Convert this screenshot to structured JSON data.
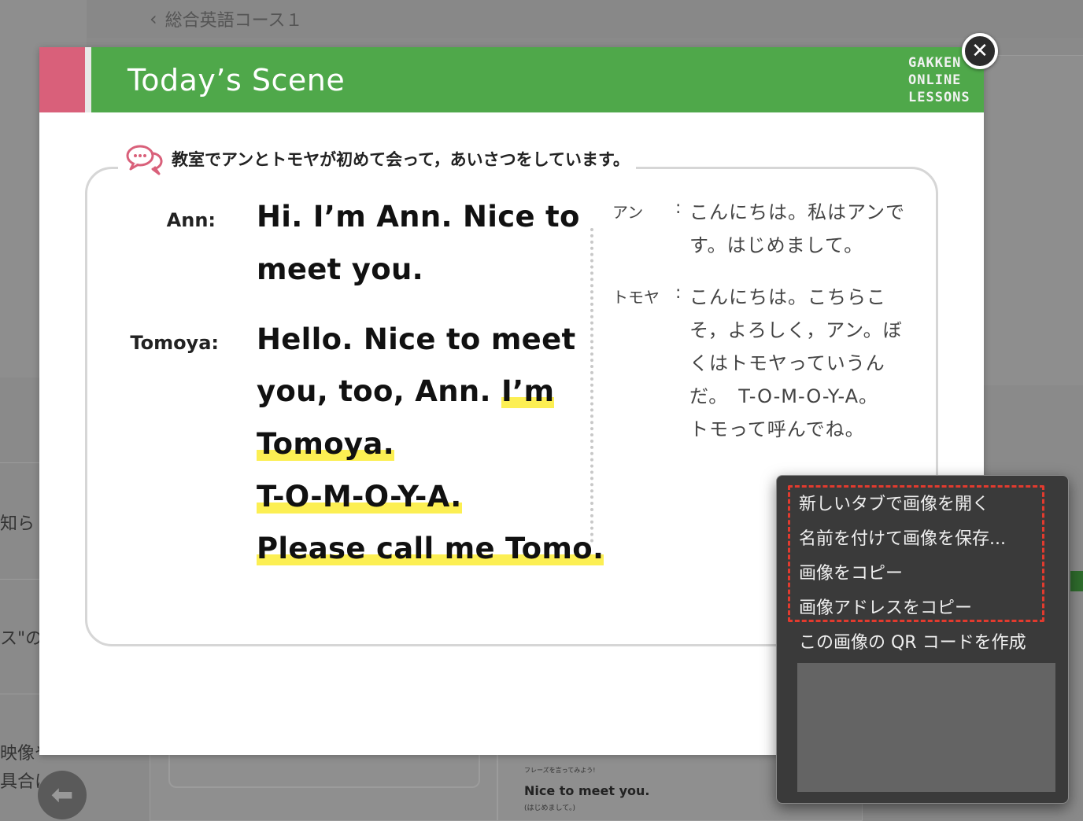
{
  "background": {
    "back_label": "総合英語コース１",
    "side_texts": [
      "知ら",
      "ス\"の",
      "映像や",
      "具合に"
    ],
    "card_phrase_hint": "フレーズを言ってみよう!",
    "card_phrase": "Nice to meet you.",
    "card_phrase_jp": "(はじめまして。)"
  },
  "modal": {
    "title": "Today’s Scene",
    "brand": [
      "GAKKEN",
      "ONLINE",
      "LESSONS"
    ],
    "intro": "教室でアンとトモヤが初めて会って，あいさつをしています。",
    "dialogue": [
      {
        "speaker": "Ann:",
        "lines": [
          "Hi.  I’m Ann.  Nice to",
          "meet you."
        ]
      },
      {
        "speaker": "Tomoya:",
        "lines": [
          "Hello.  Nice to meet",
          "you, too, Ann.",
          "I’m",
          "Tomoya.",
          "T-O-M-O-Y-A.",
          "Please call me Tomo."
        ]
      }
    ],
    "translation": [
      {
        "speaker": "アン",
        "lines": [
          "こんにちは。私はアンで",
          "す。はじめまして。"
        ]
      },
      {
        "speaker": "トモヤ",
        "lines": [
          "こんにちは。こちらこ",
          "そ，よろしく，アン。ぼ",
          "くはトモヤっていうん",
          "だ。　T-O-M-O-Y-A。",
          "トモって呼んでね。"
        ]
      }
    ]
  },
  "context_menu": {
    "items": [
      "新しいタブで画像を開く",
      "名前を付けて画像を保存...",
      "画像をコピー",
      "画像アドレスをコピー",
      "この画像の QR コードを作成"
    ]
  },
  "colors": {
    "header_green": "#4fa84a",
    "header_pink": "#d9607a",
    "highlight": "#fcef53",
    "dash_red": "#e23a2e"
  }
}
